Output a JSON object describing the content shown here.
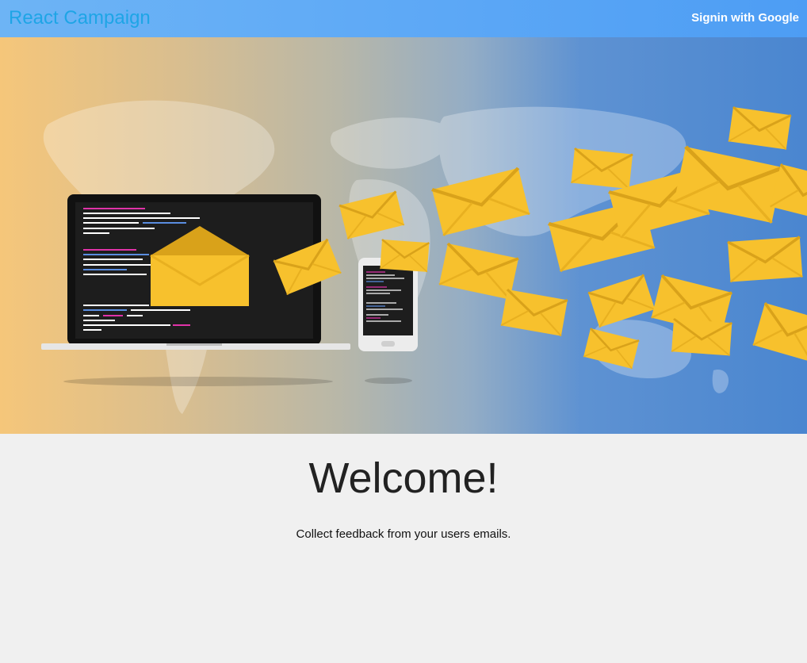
{
  "navbar": {
    "brand": "React Campaign",
    "signin_label": "Signin with Google"
  },
  "hero": {
    "illustration": "email-campaign-illustration"
  },
  "main": {
    "title": "Welcome!",
    "subtitle": "Collect feedback from your users emails."
  },
  "colors": {
    "brand": "#1ea5e6",
    "navbar": "#5ea9f6",
    "envelope": "#f7c12d",
    "background": "#f0f0f0"
  }
}
